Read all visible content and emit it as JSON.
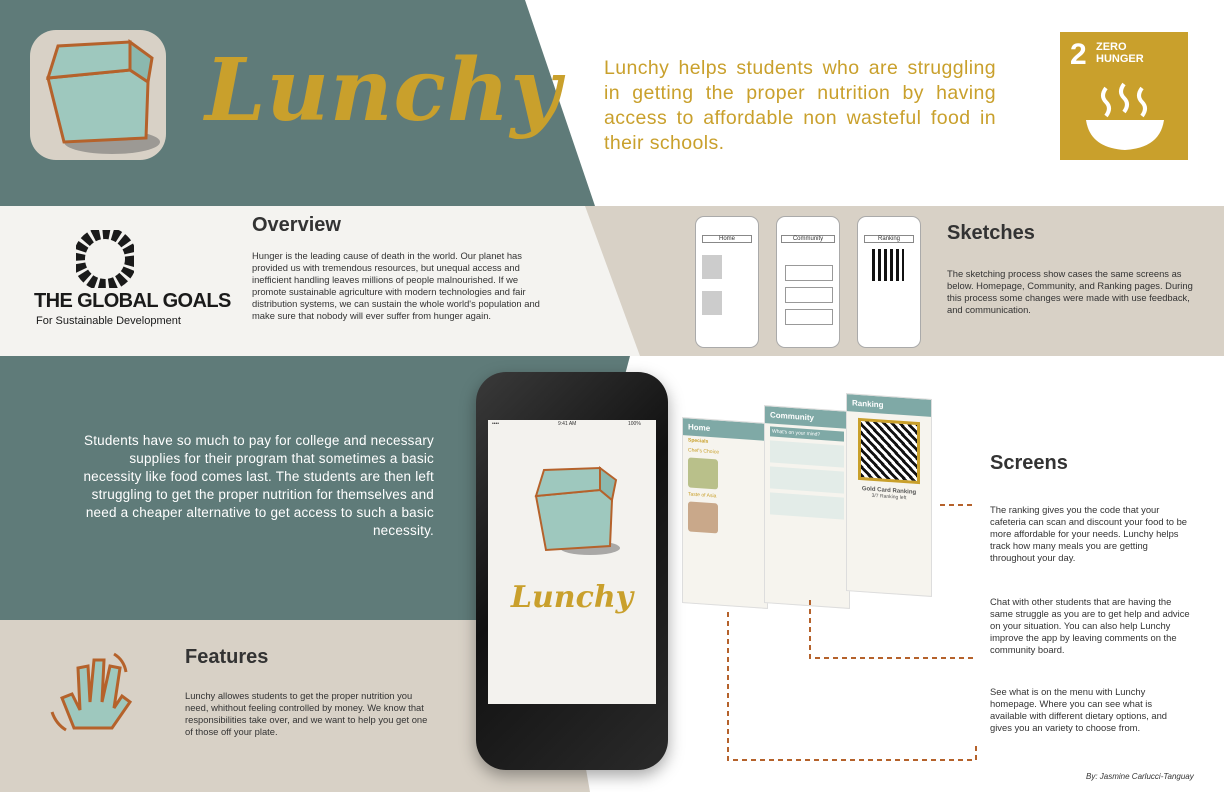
{
  "brand": {
    "name": "Lunchy",
    "tagline": "Lunchy helps students who are struggling in getting the proper nutrition by having access to affordable non wasteful food in their schools."
  },
  "sdg": {
    "number": "2",
    "label_line1": "ZERO",
    "label_line2": "HUNGER",
    "icon": "bowl-icon"
  },
  "global_goals": {
    "title": "THE GLOBAL GOALS",
    "subtitle": "For Sustainable Development"
  },
  "overview": {
    "heading": "Overview",
    "body": "Hunger is the leading cause of death in the world. Our planet has provided us with tremendous resources, but unequal access and inefficient handling leaves millions of people malnourished. If we promote sustainable agriculture with modern technologies and fair distribution systems, we can sustain the whole world's population and make sure that nobody will ever suffer from hunger again."
  },
  "sketches": {
    "heading": "Sketches",
    "body": "The sketching process show cases the same screens as below. Homepage, Community, and Ranking pages. During this process some changes were made with use feedback, and communication.",
    "labels": [
      "Home",
      "Community",
      "Ranking"
    ]
  },
  "students_text": "Students have so much to pay for college and necessary supplies for their program that sometimes a basic necessity like food comes last. The students are then left struggling to get the proper nutrition for themselves and need a cheaper alternative to get access to such a basic necessity.",
  "phone": {
    "carrier": "•••• ",
    "time": "9:41 AM",
    "battery": "100%",
    "brand": "Lunchy"
  },
  "mockups": {
    "home": {
      "title": "Home",
      "specials": "Specials",
      "item1": "Chef's Choice",
      "item2": "Taste of Asia"
    },
    "community": {
      "title": "Community",
      "search": "What's on your mind?"
    },
    "ranking": {
      "title": "Ranking",
      "card": "Gold Card Ranking",
      "left": "3/7 Ranking left"
    }
  },
  "screens": {
    "heading": "Screens",
    "desc1": "The ranking gives you the code that your cafeteria can scan and discount your food to be more affordable for your needs. Lunchy helps track how many meals you are getting throughout your day.",
    "desc2": "Chat with other students that are having the same struggle as you are to get help and advice on your situation. You can also help Lunchy improve the app by leaving comments on the community board.",
    "desc3": "See what is on the menu with Lunchy homepage. Where you can see what is available with different dietary options, and gives you an variety to choose from."
  },
  "features": {
    "heading": "Features",
    "body": "Lunchy allowes students to get the proper nutrition you need, whithout feeling controlled by money. We know that responsibilities take over, and we want to help you get one of those off your plate."
  },
  "credit": "By: Jasmine Carlucci-Tanguay",
  "colors": {
    "teal": "#5f7b79",
    "beige": "#d8d1c6",
    "gold": "#c9a02c",
    "bag": "#9ec8be",
    "bag_outline": "#b5622b"
  }
}
